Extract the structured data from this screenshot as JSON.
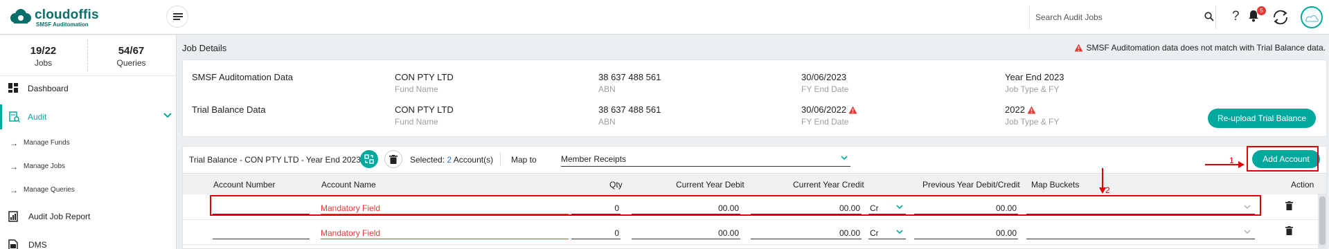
{
  "brand": {
    "name": "cloudoffis",
    "tagline": "SMSF Auditomation"
  },
  "header": {
    "search_placeholder": "Search Audit Jobs",
    "notification_count": "5",
    "icons": [
      "menu-icon",
      "search-icon",
      "help-icon",
      "bell-icon",
      "sync-icon",
      "avatar"
    ]
  },
  "sidebar": {
    "stats": [
      {
        "value": "19/22",
        "label": "Jobs"
      },
      {
        "value": "54/67",
        "label": "Queries"
      }
    ],
    "nav": [
      {
        "label": "Dashboard",
        "icon": "dashboard-icon"
      },
      {
        "label": "Audit",
        "icon": "audit-icon",
        "active": true
      }
    ],
    "sub_items": [
      {
        "label": "Manage Funds"
      },
      {
        "label": "Manage Jobs"
      },
      {
        "label": "Manage Queries"
      }
    ],
    "bottom_nav": [
      {
        "label": "Audit Job Report",
        "icon": "report-icon"
      },
      {
        "label": "DMS",
        "icon": "dms-icon"
      }
    ]
  },
  "job_details": {
    "title": "Job Details",
    "warning": "SMSF Auditomation data does not match with Trial Balance data.",
    "rows": [
      {
        "label": "SMSF Auditomation Data",
        "fund_name": "CON PTY LTD",
        "fund_name_label": "Fund Name",
        "abn": "38 637 488 561",
        "abn_label": "ABN",
        "fy_end": "30/06/2023",
        "fy_end_label": "FY End Date",
        "job_type": "Year End 2023",
        "job_type_label": "Job Type & FY"
      },
      {
        "label": "Trial Balance Data",
        "fund_name": "CON PTY LTD",
        "fund_name_label": "Fund Name",
        "abn": "38 637 488 561",
        "abn_label": "ABN",
        "fy_end": "30/06/2022",
        "fy_end_label": "FY End Date",
        "job_type": "2022",
        "job_type_label": "Job Type & FY"
      }
    ],
    "reupload_label": "Re-upload Trial Balance"
  },
  "trial_balance": {
    "title": "Trial Balance - CON PTY LTD - Year End 2023",
    "selected_prefix": "Selected:",
    "selected_count": "2",
    "selected_suffix": "Account(s)",
    "map_to_label": "Map to",
    "map_to_value": "Member Receipts",
    "add_account_label": "Add Account",
    "columns": [
      "Account Number",
      "Account Name",
      "Qty",
      "Current Year Debit",
      "Current Year Credit",
      "Previous Year Debit/Credit",
      "Map Buckets",
      "Action"
    ],
    "rows": [
      {
        "account_number": "",
        "account_name": "Mandatory Field",
        "qty": "0",
        "debit": "00.00",
        "credit": "00.00",
        "dr_cr": "Cr",
        "previous": "00.00",
        "bucket": ""
      },
      {
        "account_number": "",
        "account_name": "Mandatory Field",
        "qty": "0",
        "debit": "00.00",
        "credit": "00.00",
        "dr_cr": "Cr",
        "previous": "00.00",
        "bucket": ""
      }
    ]
  },
  "annotations": {
    "label_1": "1",
    "label_2": "2"
  },
  "colors": {
    "accent": "#00a99d",
    "warning": "#e53935",
    "annotation": "#e00000"
  }
}
